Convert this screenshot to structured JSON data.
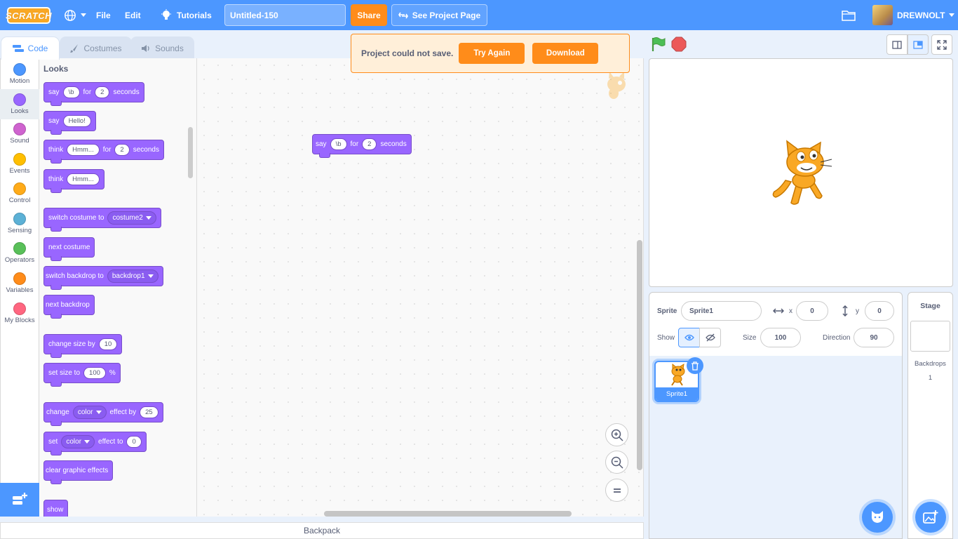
{
  "menubar": {
    "logo": "SCRATCH",
    "file": "File",
    "edit": "Edit",
    "tutorials": "Tutorials",
    "project_title": "Untitled-150",
    "share": "Share",
    "see_project_page": "See Project Page",
    "username": "DREWNOLT"
  },
  "tabs": {
    "code": "Code",
    "costumes": "Costumes",
    "sounds": "Sounds"
  },
  "categories": [
    {
      "label": "Motion",
      "color": "#4c97ff"
    },
    {
      "label": "Looks",
      "color": "#9966ff"
    },
    {
      "label": "Sound",
      "color": "#cf63cf"
    },
    {
      "label": "Events",
      "color": "#ffbf00"
    },
    {
      "label": "Control",
      "color": "#ffab19"
    },
    {
      "label": "Sensing",
      "color": "#5cb1d6"
    },
    {
      "label": "Operators",
      "color": "#59c059"
    },
    {
      "label": "Variables",
      "color": "#ff8c1a"
    },
    {
      "label": "My Blocks",
      "color": "#ff6680"
    }
  ],
  "flyout": {
    "heading": "Looks",
    "say_for": {
      "say": "say",
      "msg": "\\b",
      "for": "for",
      "secs": "2",
      "seconds": "seconds"
    },
    "say": {
      "say": "say",
      "msg": "Hello!"
    },
    "think_for": {
      "think": "think",
      "msg": "Hmm...",
      "for": "for",
      "secs": "2",
      "seconds": "seconds"
    },
    "think": {
      "think": "think",
      "msg": "Hmm..."
    },
    "switch_costume": {
      "text": "switch costume to",
      "value": "costume2"
    },
    "next_costume": "next costume",
    "switch_backdrop": {
      "text": "switch backdrop to",
      "value": "backdrop1"
    },
    "next_backdrop": "next backdrop",
    "change_size": {
      "text": "change size by",
      "value": "10"
    },
    "set_size": {
      "text": "set size to",
      "value": "100",
      "unit": "%"
    },
    "change_effect": {
      "change": "change",
      "effect": "color",
      "by": "effect by",
      "value": "25"
    },
    "set_effect": {
      "set": "set",
      "effect": "color",
      "to": "effect to",
      "value": "0"
    },
    "clear_effects": "clear graphic effects",
    "show": "show"
  },
  "workspace_block": {
    "say": "say",
    "msg": "\\b",
    "for": "for",
    "secs": "2",
    "seconds": "seconds"
  },
  "alert": {
    "message": "Project could not save.",
    "try_again": "Try Again",
    "download": "Download"
  },
  "backpack": "Backpack",
  "sprite_info": {
    "sprite_label": "Sprite",
    "sprite_name": "Sprite1",
    "x_label": "x",
    "x": "0",
    "y_label": "y",
    "y": "0",
    "show_label": "Show",
    "size_label": "Size",
    "size": "100",
    "direction_label": "Direction",
    "direction": "90"
  },
  "sprites": [
    {
      "name": "Sprite1"
    }
  ],
  "stage_panel": {
    "title": "Stage",
    "backdrops_label": "Backdrops",
    "backdrops_count": "1"
  }
}
